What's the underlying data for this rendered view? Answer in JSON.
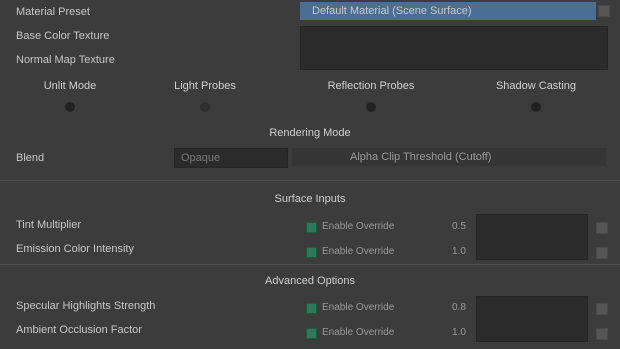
{
  "top": {
    "labels": [
      "Material Preset",
      "Base Color Texture",
      "Normal Map Texture"
    ],
    "preset_value": "Default Material (Scene Surface)"
  },
  "columns": [
    "Unlit Mode",
    "Light Probes",
    "Reflection Probes",
    "Shadow Casting"
  ],
  "section1": {
    "title": "Rendering Mode",
    "row_label": "Blend",
    "mode_value": "Opaque",
    "wide_value": "Alpha Clip Threshold (Cutoff)"
  },
  "section2": {
    "title": "Surface Inputs",
    "rows": [
      {
        "label": "Tint Multiplier",
        "check_text": "Enable Override",
        "value": "0.5"
      },
      {
        "label": "Emission Color Intensity",
        "check_text": "Enable Override",
        "value": "1.0"
      }
    ]
  },
  "section3": {
    "title": "Advanced Options",
    "rows": [
      {
        "label": "Specular Highlights Strength",
        "check_text": "Enable Override",
        "value": "0.8"
      },
      {
        "label": "Ambient Occlusion Factor",
        "check_text": "Enable Override",
        "value": "1.0"
      }
    ]
  },
  "colors": {
    "background": "#3c3c3c",
    "field": "#2b2b2b",
    "accent": "#4a6e96",
    "checkbox": "#2c7a5a"
  }
}
